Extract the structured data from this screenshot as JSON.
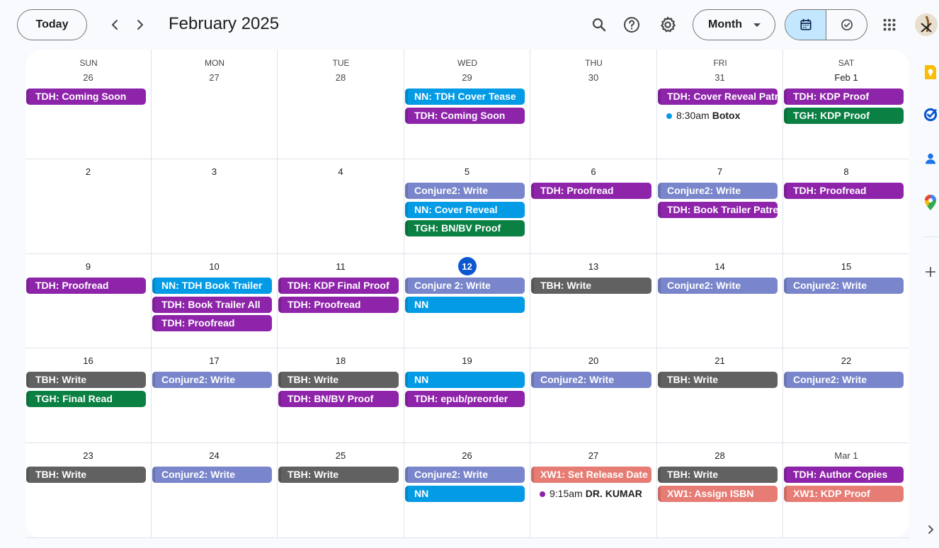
{
  "header": {
    "today_label": "Today",
    "title": "February 2025",
    "view_label": "Month",
    "icons": [
      "chevron-left-icon",
      "chevron-right-icon",
      "search-icon",
      "help-icon",
      "settings-icon",
      "calendar-view-icon",
      "tasks-view-icon",
      "apps-grid-icon"
    ]
  },
  "days_of_week": [
    "SUN",
    "MON",
    "TUE",
    "WED",
    "THU",
    "FRI",
    "SAT"
  ],
  "today": "12",
  "weeks": [
    [
      {
        "label": "26",
        "muted": true,
        "events": [
          {
            "title": "TDH: Coming Soon",
            "color": "#8e24aa"
          }
        ]
      },
      {
        "label": "27",
        "muted": true,
        "events": []
      },
      {
        "label": "28",
        "muted": true,
        "events": []
      },
      {
        "label": "29",
        "muted": true,
        "events": [
          {
            "title": "NN: TDH Cover Tease",
            "color": "#039be5"
          },
          {
            "title": "TDH: Coming Soon",
            "color": "#8e24aa"
          }
        ]
      },
      {
        "label": "30",
        "muted": true,
        "events": []
      },
      {
        "label": "31",
        "muted": true,
        "events": [
          {
            "title": "TDH: Cover Reveal Patre",
            "color": "#8e24aa"
          },
          {
            "timed": true,
            "time": "8:30am",
            "title": "Botox",
            "color": "#039be5"
          }
        ]
      },
      {
        "label": "Feb 1",
        "muted": false,
        "events": [
          {
            "title": "TDH: KDP Proof",
            "color": "#8e24aa"
          },
          {
            "title": "TGH: KDP Proof",
            "color": "#0b8043"
          }
        ]
      }
    ],
    [
      {
        "label": "2",
        "events": []
      },
      {
        "label": "3",
        "events": []
      },
      {
        "label": "4",
        "events": []
      },
      {
        "label": "5",
        "events": [
          {
            "title": "Conjure2: Write",
            "color": "#7986cb"
          },
          {
            "title": "NN: Cover Reveal",
            "color": "#039be5"
          },
          {
            "title": "TGH: BN/BV Proof",
            "color": "#0b8043"
          }
        ]
      },
      {
        "label": "6",
        "events": [
          {
            "title": "TDH: Proofread",
            "color": "#8e24aa"
          }
        ]
      },
      {
        "label": "7",
        "events": [
          {
            "title": "Conjure2: Write",
            "color": "#7986cb"
          },
          {
            "title": "TDH: Book Trailer Patreo",
            "color": "#8e24aa"
          }
        ]
      },
      {
        "label": "8",
        "events": [
          {
            "title": "TDH: Proofread",
            "color": "#8e24aa"
          }
        ]
      }
    ],
    [
      {
        "label": "9",
        "events": [
          {
            "title": "TDH: Proofread",
            "color": "#8e24aa"
          }
        ]
      },
      {
        "label": "10",
        "events": [
          {
            "title": "NN: TDH Book Trailer",
            "color": "#039be5"
          },
          {
            "title": "TDH: Book Trailer All",
            "color": "#8e24aa"
          },
          {
            "title": "TDH: Proofread",
            "color": "#8e24aa"
          }
        ]
      },
      {
        "label": "11",
        "events": [
          {
            "title": "TDH: KDP Final Proof",
            "color": "#8e24aa"
          },
          {
            "title": "TDH: Proofread",
            "color": "#8e24aa"
          }
        ]
      },
      {
        "label": "12",
        "events": [
          {
            "title": "Conjure 2: Write",
            "color": "#7986cb"
          },
          {
            "title": "NN",
            "color": "#039be5"
          }
        ]
      },
      {
        "label": "13",
        "events": [
          {
            "title": "TBH: Write",
            "color": "#616161"
          }
        ]
      },
      {
        "label": "14",
        "events": [
          {
            "title": "Conjure2: Write",
            "color": "#7986cb"
          }
        ]
      },
      {
        "label": "15",
        "events": [
          {
            "title": "Conjure2: Write",
            "color": "#7986cb"
          }
        ]
      }
    ],
    [
      {
        "label": "16",
        "events": [
          {
            "title": "TBH: Write",
            "color": "#616161"
          },
          {
            "title": "TGH: Final Read",
            "color": "#0b8043"
          }
        ]
      },
      {
        "label": "17",
        "events": [
          {
            "title": "Conjure2: Write",
            "color": "#7986cb"
          }
        ]
      },
      {
        "label": "18",
        "events": [
          {
            "title": "TBH: Write",
            "color": "#616161"
          },
          {
            "title": "TDH: BN/BV Proof",
            "color": "#8e24aa"
          }
        ]
      },
      {
        "label": "19",
        "events": [
          {
            "title": "NN",
            "color": "#039be5"
          },
          {
            "title": "TDH: epub/preorder",
            "color": "#8e24aa"
          }
        ]
      },
      {
        "label": "20",
        "events": [
          {
            "title": "Conjure2: Write",
            "color": "#7986cb"
          }
        ]
      },
      {
        "label": "21",
        "events": [
          {
            "title": "TBH: Write",
            "color": "#616161"
          }
        ]
      },
      {
        "label": "22",
        "events": [
          {
            "title": "Conjure2: Write",
            "color": "#7986cb"
          }
        ]
      }
    ],
    [
      {
        "label": "23",
        "events": [
          {
            "title": "TBH: Write",
            "color": "#616161"
          }
        ]
      },
      {
        "label": "24",
        "events": [
          {
            "title": "Conjure2: Write",
            "color": "#7986cb"
          }
        ]
      },
      {
        "label": "25",
        "events": [
          {
            "title": "TBH: Write",
            "color": "#616161"
          }
        ]
      },
      {
        "label": "26",
        "events": [
          {
            "title": "Conjure2: Write",
            "color": "#7986cb"
          },
          {
            "title": "NN",
            "color": "#039be5"
          }
        ]
      },
      {
        "label": "27",
        "events": [
          {
            "title": "XW1: Set Release Date",
            "color": "#e67c73"
          },
          {
            "timed": true,
            "time": "9:15am",
            "title": "DR. KUMAR",
            "color": "#8e24aa"
          }
        ]
      },
      {
        "label": "28",
        "events": [
          {
            "title": "TBH: Write",
            "color": "#616161"
          },
          {
            "title": "XW1: Assign ISBN",
            "color": "#e67c73"
          }
        ]
      },
      {
        "label": "Mar 1",
        "muted": true,
        "events": [
          {
            "title": "TDH: Author Copies",
            "color": "#8e24aa"
          },
          {
            "title": "XW1: KDP Proof",
            "color": "#e67c73"
          }
        ]
      }
    ]
  ],
  "side_panel": {
    "icons": [
      "keep-icon",
      "tasks-icon",
      "contacts-icon",
      "maps-icon",
      "add-icon",
      "chevron-right-icon"
    ]
  }
}
